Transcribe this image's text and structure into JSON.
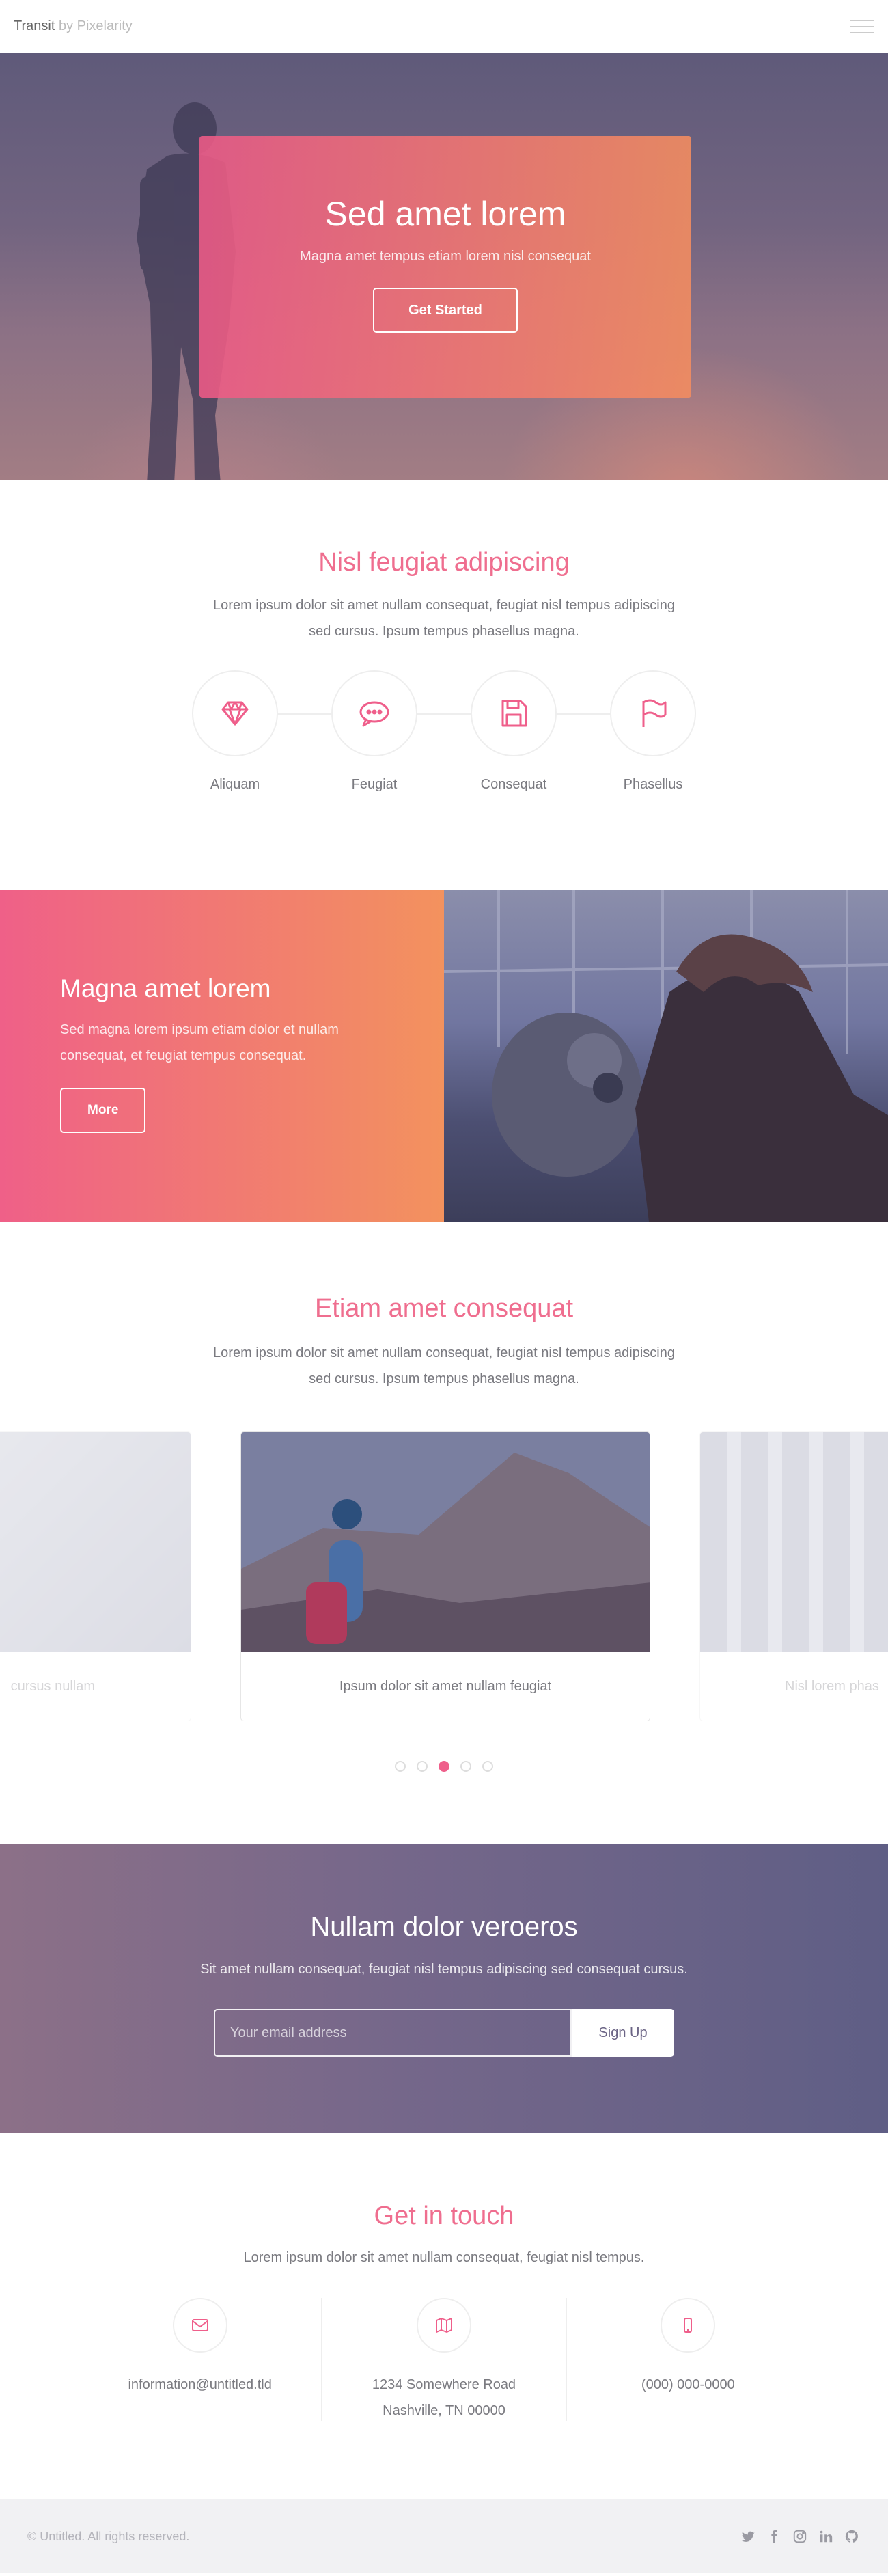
{
  "header": {
    "logo_main": "Transit",
    "logo_by": " by Pixelarity"
  },
  "banner": {
    "title": "Sed amet lorem",
    "subtitle": "Magna amet tempus etiam lorem nisl consequat",
    "button": "Get Started"
  },
  "features": {
    "title": "Nisl feugiat adipiscing",
    "text": "Lorem ipsum dolor sit amet nullam consequat, feugiat nisl tempus adipiscing sed cursus. Ipsum tempus phasellus magna.",
    "items": [
      {
        "label": "Aliquam",
        "icon": "diamond-icon"
      },
      {
        "label": "Feugiat",
        "icon": "comment-icon"
      },
      {
        "label": "Consequat",
        "icon": "save-icon"
      },
      {
        "label": "Phasellus",
        "icon": "flag-icon"
      }
    ]
  },
  "spotlight": {
    "title": "Magna amet lorem",
    "text": "Sed magna lorem ipsum etiam dolor et nullam consequat, et feugiat tempus consequat.",
    "button": "More"
  },
  "carousel": {
    "title": "Etiam amet consequat",
    "text": "Lorem ipsum dolor sit amet nullam consequat, feugiat nisl tempus adipiscing sed cursus. Ipsum tempus phasellus magna.",
    "cards": [
      {
        "caption": "cursus nullam"
      },
      {
        "caption": "Ipsum dolor sit amet nullam feugiat"
      },
      {
        "caption": "Nisl lorem phas"
      }
    ],
    "active_dot": 3,
    "dot_count": 5
  },
  "signup": {
    "title": "Nullam dolor veroeros",
    "text": "Sit amet nullam consequat, feugiat nisl tempus adipiscing sed consequat cursus.",
    "placeholder": "Your email address",
    "button": "Sign Up"
  },
  "contact": {
    "title": "Get in touch",
    "text": "Lorem ipsum dolor sit amet nullam consequat, feugiat nisl tempus.",
    "items": [
      {
        "icon": "envelope-icon",
        "line1": "information@untitled.tld",
        "line2": ""
      },
      {
        "icon": "map-icon",
        "line1": "1234 Somewhere Road",
        "line2": "Nashville, TN 00000"
      },
      {
        "icon": "phone-icon",
        "line1": "(000) 000-0000",
        "line2": ""
      }
    ]
  },
  "footer": {
    "copyright": "© Untitled. All rights reserved.",
    "social": [
      "twitter-icon",
      "facebook-icon",
      "instagram-icon",
      "linkedin-icon",
      "github-icon"
    ]
  },
  "colors": {
    "accent": "#ef6e8f",
    "gradient_start": "#ef6088",
    "gradient_end": "#f3925e",
    "signup_start": "#8c7088",
    "signup_end": "#5f5e85"
  }
}
